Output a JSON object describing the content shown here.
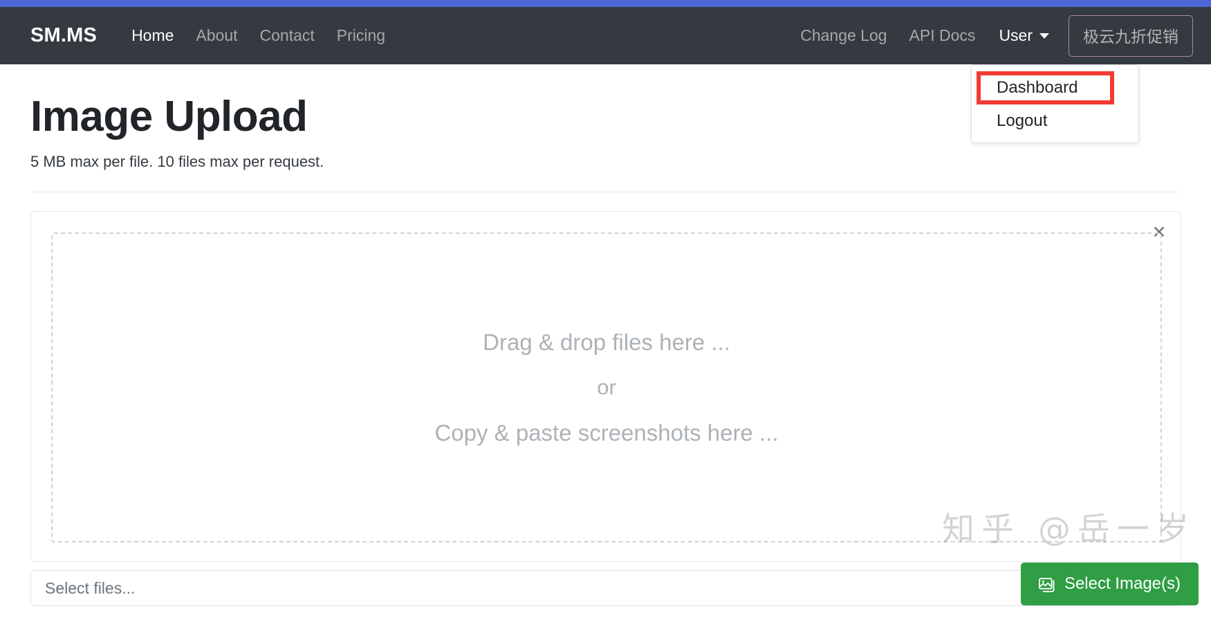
{
  "theme": {
    "accent_bar": "#4d66d8",
    "navbar_bg": "#343a40",
    "highlight_box": "#f33b33",
    "primary_button": "#2f9e44",
    "promo_border": "#b08ba0"
  },
  "navbar": {
    "brand": "SM.MS",
    "left_links": [
      {
        "label": "Home",
        "active": true
      },
      {
        "label": "About",
        "active": false
      },
      {
        "label": "Contact",
        "active": false
      },
      {
        "label": "Pricing",
        "active": false
      }
    ],
    "right_links": [
      {
        "label": "Change Log"
      },
      {
        "label": "API Docs"
      }
    ],
    "user_menu": {
      "label": "User",
      "caret_icon": "chevron-down-icon",
      "items": [
        {
          "label": "Dashboard",
          "highlighted": true
        },
        {
          "label": "Logout",
          "highlighted": false
        }
      ]
    },
    "promo_button": "极云九折促销"
  },
  "page": {
    "title": "Image Upload",
    "subtitle": "5 MB max per file. 10 files max per request."
  },
  "upload_card": {
    "close_icon_glyph": "✕",
    "dropzone": {
      "line1": "Drag & drop files here ...",
      "line2": "or",
      "line3": "Copy & paste screenshots here ..."
    }
  },
  "file_row": {
    "input_value": "",
    "input_placeholder": "Select files...",
    "button_label": "Select Image(s)",
    "button_icon": "image-icon"
  },
  "watermark": {
    "text": "知乎 @岳一岁"
  }
}
